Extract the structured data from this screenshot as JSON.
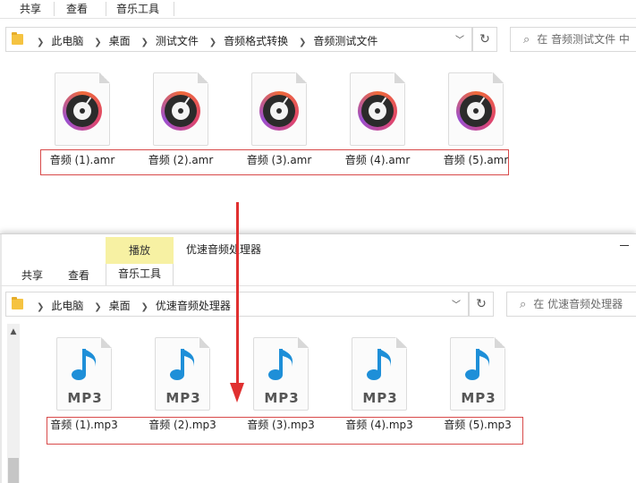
{
  "top_window": {
    "ribbon_tabs": [
      "共享",
      "查看",
      "音乐工具"
    ],
    "breadcrumb": [
      "此电脑",
      "桌面",
      "测试文件",
      "音频格式转换",
      "音频测试文件"
    ],
    "search_placeholder": "在 音频测试文件 中",
    "files": [
      {
        "name": "音频 (1).amr",
        "icon": "vinyl-record-icon"
      },
      {
        "name": "音频 (2).amr",
        "icon": "vinyl-record-icon"
      },
      {
        "name": "音频 (3).amr",
        "icon": "vinyl-record-icon"
      },
      {
        "name": "音频 (4).amr",
        "icon": "vinyl-record-icon"
      },
      {
        "name": "音频 (5).amr",
        "icon": "vinyl-record-icon"
      }
    ]
  },
  "bottom_window": {
    "context_tab": "播放",
    "title": "优速音频处理器",
    "ribbon_tabs": [
      "共享",
      "查看",
      "音乐工具"
    ],
    "breadcrumb": [
      "此电脑",
      "桌面",
      "优速音频处理器"
    ],
    "search_placeholder": "在 优速音频处理器",
    "files": [
      {
        "name": "音频 (1).mp3",
        "badge": "MP3"
      },
      {
        "name": "音频 (2).mp3",
        "badge": "MP3"
      },
      {
        "name": "音频 (3).mp3",
        "badge": "MP3"
      },
      {
        "name": "音频 (4).mp3",
        "badge": "MP3"
      },
      {
        "name": "音频 (5).mp3",
        "badge": "MP3"
      }
    ]
  },
  "colors": {
    "highlight_red": "#d84a4a",
    "arrow_red": "#e03030",
    "play_tab_yellow": "#f7f1a3",
    "folder_yellow": "#f5c341",
    "mp3_blue": "#1e8fd8"
  }
}
